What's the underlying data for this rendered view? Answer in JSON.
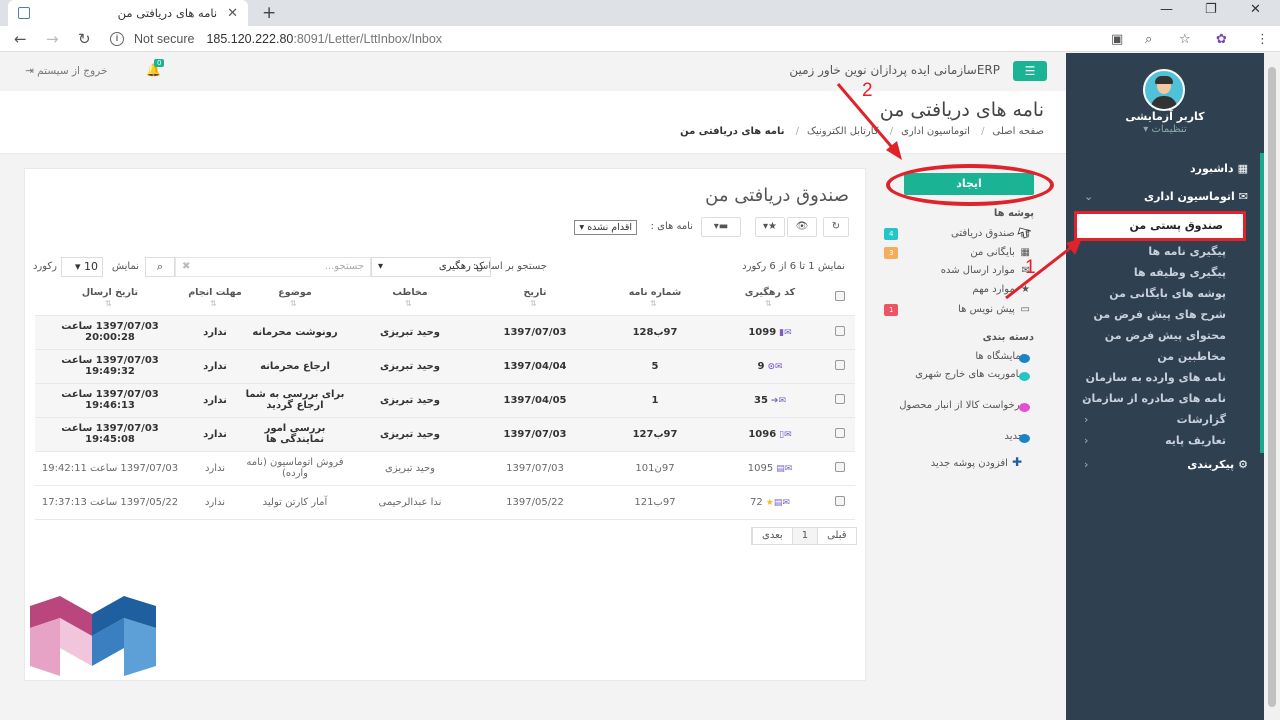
{
  "browser": {
    "tab_title": "نامه های دریافتی من",
    "new_tab": "+",
    "not_secure": "Not secure",
    "url_host": "185.120.222.80",
    "url_rest": ":8091/Letter/LttInbox/Inbox"
  },
  "header": {
    "org_name": "ERPسازمانی ایده پردازان نوین خاور زمین",
    "logout": "خروج از سیستم",
    "notif_count": "0"
  },
  "sidebar": {
    "user_name": "کاربر آزمایشی",
    "user_settings": "تنظیمات",
    "items": [
      {
        "label": "داشبورد",
        "icon": "dashboard-icon"
      },
      {
        "label": "اتوماسیون اداری",
        "icon": "envelope-icon"
      },
      {
        "label": "صندوق پستی من"
      },
      {
        "label": "پیگیری نامه ها"
      },
      {
        "label": "پیگیری وظیفه ها"
      },
      {
        "label": "پوشه های بایگانی من"
      },
      {
        "label": "شرح های پیش فرض من"
      },
      {
        "label": "محتوای پیش فرض من"
      },
      {
        "label": "مخاطبین من"
      },
      {
        "label": "نامه های وارده به سازمان"
      },
      {
        "label": "نامه های صادره از سازمان"
      },
      {
        "label": "گزارشات"
      },
      {
        "label": "تعاریف پایه"
      },
      {
        "label": "پیکربندی",
        "icon": "gears-icon"
      }
    ]
  },
  "page": {
    "title": "نامه های دریافتی من",
    "breadcrumb": [
      "صفحه اصلی",
      "اتوماسیون اداری",
      "کارتابل الکترونیک",
      "نامه های دریافتی من"
    ]
  },
  "folders": {
    "create": "ایجاد",
    "section_folders": "پوشه ها",
    "items": [
      {
        "label": "صندوق دریافتی",
        "badge": "4",
        "color": "#23c6c8"
      },
      {
        "label": "بایگانی من",
        "badge": "3",
        "color": "#f8ac59"
      },
      {
        "label": "موارد ارسال شده",
        "badge": ""
      },
      {
        "label": "موارد مهم",
        "badge": ""
      },
      {
        "label": "پیش نویس ها",
        "badge": "1",
        "color": "#ed5565"
      }
    ],
    "section_categories": "دسته بندی",
    "categories": [
      {
        "label": "نمایشگاه ها",
        "color": "#1c84c6"
      },
      {
        "label": "ماموریت های خارج شهری",
        "color": "#23c6c8"
      },
      {
        "label": "درخواست کالا از انبار محصول",
        "color": "#e54fd3"
      },
      {
        "label": "جدید",
        "color": "#1c84c6"
      }
    ],
    "add_folder": "افزودن پوشه جدید"
  },
  "inbox": {
    "title": "صندوق دریافتی من",
    "letters_label": "نامه های :",
    "filter_value": "اقدام نشده",
    "info": "نمایش 1 تا 6 از 6 رکورد",
    "search_label": "جستجو بر اساس:",
    "search_field": "کد رهگیری",
    "search_placeholder": "جستجو...",
    "show_label": "نمایش",
    "page_len": "10",
    "records": "رکورد",
    "columns": [
      "کد رهگیری",
      "شماره نامه",
      "تاریخ",
      "مخاطب",
      "موضوع",
      "مهلت انجام",
      "تاریخ ارسال"
    ],
    "rows": [
      {
        "code": "1099",
        "number": "97ب128",
        "date": "1397/07/03",
        "contact": "وحید تبریزی",
        "subject": "رونوشت محرمانه",
        "deadline": "ندارد",
        "sent": "1397/07/03 ساعت 20:00:28",
        "unread": true
      },
      {
        "code": "9",
        "number": "5",
        "date": "1397/04/04",
        "contact": "وحید تبریزی",
        "subject": "ارجاع محرمانه",
        "deadline": "ندارد",
        "sent": "1397/07/03 ساعت 19:49:32",
        "unread": true
      },
      {
        "code": "35",
        "number": "1",
        "date": "1397/04/05",
        "contact": "وحید تبریزی",
        "subject": "برای بررسی به شما ارجاع گردید",
        "deadline": "ندارد",
        "sent": "1397/07/03 ساعت 19:46:13",
        "unread": true
      },
      {
        "code": "1096",
        "number": "97ب127",
        "date": "1397/07/03",
        "contact": "وحید تبریزی",
        "subject": "بررسی امور نمایندگی ها",
        "deadline": "ندارد",
        "sent": "1397/07/03 ساعت 19:45:08",
        "unread": true
      },
      {
        "code": "1095",
        "number": "97ن101",
        "date": "1397/07/03",
        "contact": "وحید تبریزی",
        "subject": "فروش اتوماسیون (نامه وارده)",
        "deadline": "ندارد",
        "sent": "1397/07/03 ساعت 19:42:11",
        "unread": false
      },
      {
        "code": "72",
        "number": "97ب121",
        "date": "1397/05/22",
        "contact": "ندا عبدالرحیمی",
        "subject": "آمار کارتن تولید",
        "deadline": "ندارد",
        "sent": "1397/05/22 ساعت 17:37:13",
        "unread": false
      }
    ],
    "pager": {
      "prev": "قبلی",
      "page": "1",
      "next": "بعدی"
    }
  },
  "annotations": {
    "one": "1",
    "two": "2"
  },
  "colors": {
    "accent": "#1ab394",
    "sidebar": "#2f4050",
    "highlight": "#e0222a"
  }
}
